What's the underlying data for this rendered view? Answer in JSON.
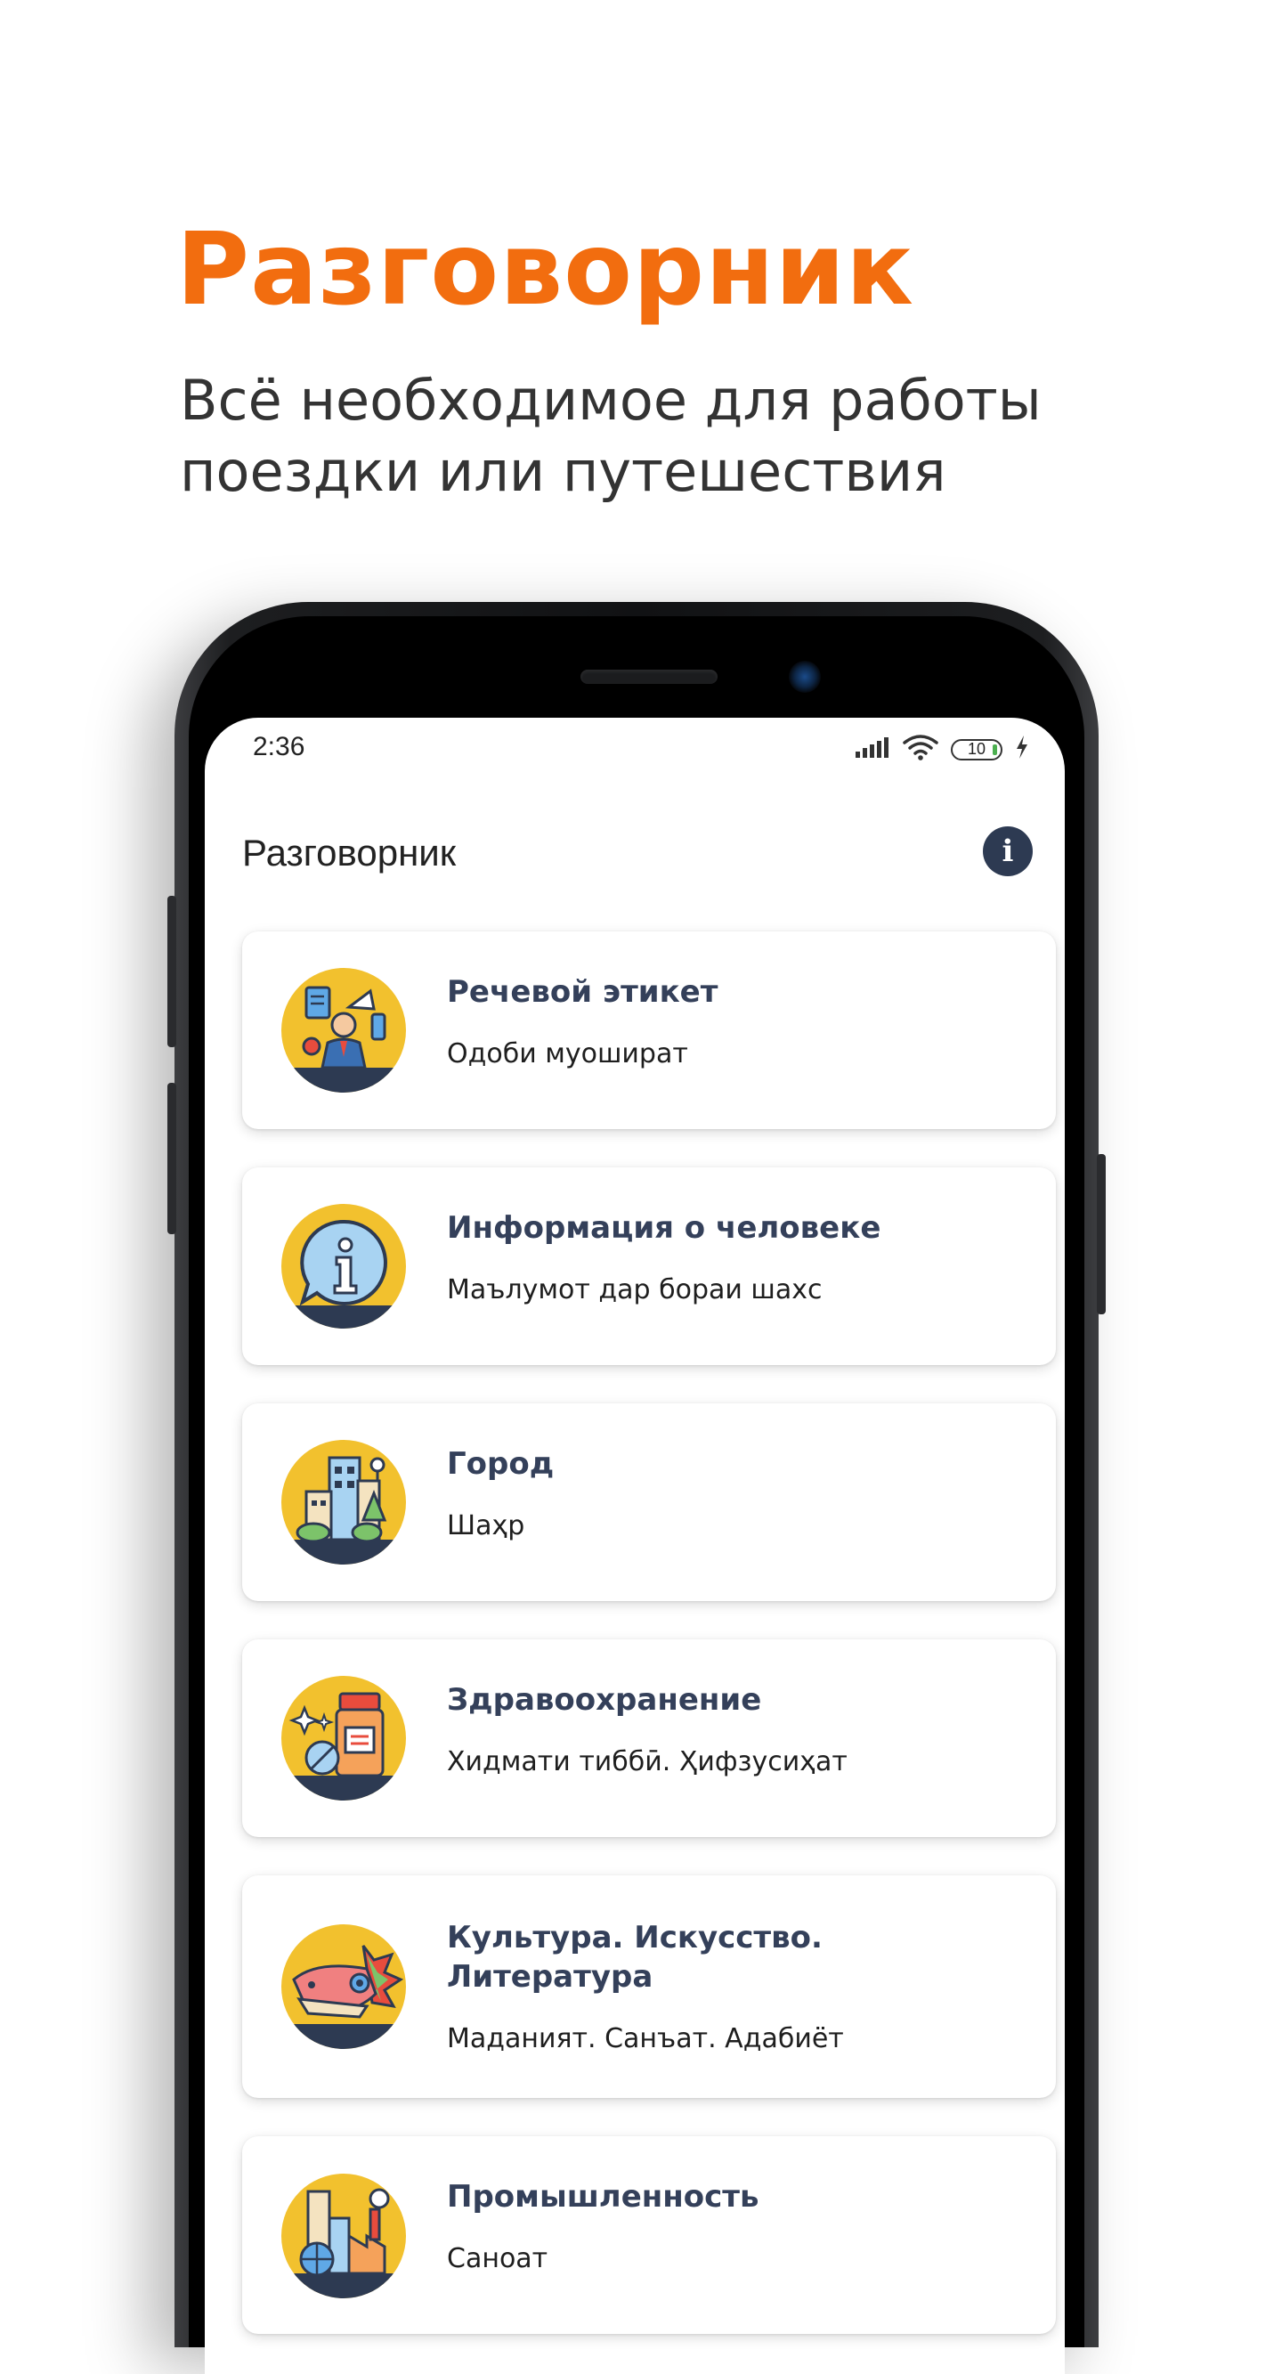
{
  "promo": {
    "title": "Разговорник",
    "subtitle": "Всё необходимое для работы\nпоездки или путешествия"
  },
  "status_bar": {
    "time": "2:36",
    "battery_level": "10"
  },
  "app_bar": {
    "title": "Разговорник",
    "info_icon": "info-icon"
  },
  "topics": [
    {
      "title": "Речевой этикет",
      "subtitle": "Одоби муошират",
      "icon": "speech-etiquette-icon"
    },
    {
      "title": "Информация о человеке",
      "subtitle": "Маълумот дар бораи шахс",
      "icon": "info-bubble-icon"
    },
    {
      "title": "Город",
      "subtitle": "Шаҳр",
      "icon": "city-icon"
    },
    {
      "title": "Здравоохранение",
      "subtitle": "Хидмати тиббӣ. Ҳифзусиҳат",
      "icon": "medicine-icon"
    },
    {
      "title": "Культура. Искусство.\nЛитература",
      "subtitle": "Маданият. Санъат. Адабиёт",
      "icon": "culture-mask-icon"
    },
    {
      "title": "Промышленность",
      "subtitle": "Саноат",
      "icon": "industry-icon"
    }
  ],
  "colors": {
    "accent": "#f26d0f",
    "icon_background": "#f2c12e",
    "title_text": "#34405a",
    "info_button": "#2d3a52"
  }
}
